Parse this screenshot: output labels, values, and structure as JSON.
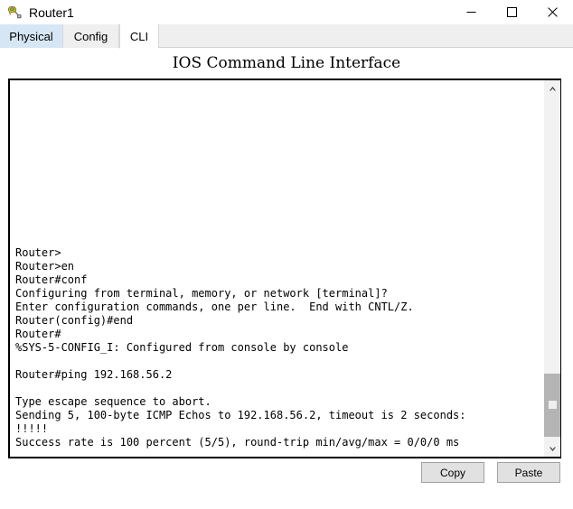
{
  "window": {
    "title": "Router1",
    "icon": "router-device-icon",
    "controls": {
      "minimize": "Minimize",
      "maximize": "Maximize",
      "close": "Close"
    }
  },
  "tabs": [
    {
      "label": "Physical",
      "state": "hovered"
    },
    {
      "label": "Config",
      "state": "inactive"
    },
    {
      "label": "CLI",
      "state": "active"
    }
  ],
  "panel": {
    "header": "IOS Command Line Interface"
  },
  "terminal": {
    "blank_lines_before": 12,
    "lines": [
      "Router>",
      "Router>en",
      "Router#conf",
      "Configuring from terminal, memory, or network [terminal]?",
      "Enter configuration commands, one per line.  End with CNTL/Z.",
      "Router(config)#end",
      "Router#",
      "%SYS-5-CONFIG_I: Configured from console by console",
      "",
      "Router#ping 192.168.56.2",
      "",
      "Type escape sequence to abort.",
      "Sending 5, 100-byte ICMP Echos to 192.168.56.2, timeout is 2 seconds:",
      "!!!!!",
      "Success rate is 100 percent (5/5), round-trip min/avg/max = 0/0/0 ms",
      ""
    ],
    "prompt": "Router#",
    "cursor_visible": true
  },
  "scrollbar": {
    "up_arrow": "scroll-up-arrow-icon",
    "down_arrow": "scroll-down-arrow-icon",
    "thumb_top_pct": 80.5,
    "thumb_height_pct": 18.5
  },
  "buttons": {
    "copy": "Copy",
    "paste": "Paste"
  },
  "colors": {
    "tab_hover": "#d6e6f5",
    "tab_inactive": "#efefef",
    "tab_active": "#ffffff",
    "terminal_border": "#000000",
    "terminal_bg": "#ffffff",
    "scrollbar_thumb": "#b4b4b4",
    "button_face": "#e1e1e1"
  }
}
